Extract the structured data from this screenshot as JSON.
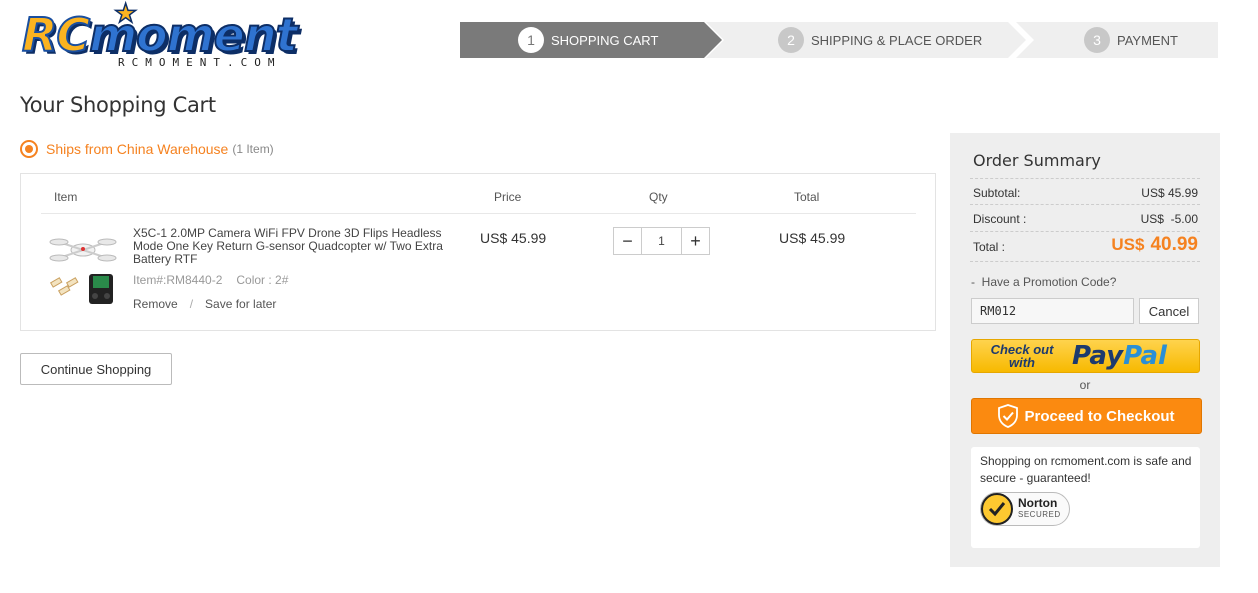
{
  "logo": {
    "rc": "RC",
    "moment": "moment",
    "domain": "RCMOMENT.COM"
  },
  "steps": [
    {
      "num": "1",
      "label": "SHOPPING CART"
    },
    {
      "num": "2",
      "label": "SHIPPING & PLACE ORDER"
    },
    {
      "num": "3",
      "label": "PAYMENT"
    }
  ],
  "page_title": "Your Shopping Cart",
  "warehouse": {
    "name": "Ships from China Warehouse",
    "count": "(1 Item)"
  },
  "cart": {
    "headers": {
      "item": "Item",
      "price": "Price",
      "qty": "Qty",
      "total": "Total"
    },
    "items": [
      {
        "title": "X5C-1 2.0MP Camera WiFi FPV Drone 3D Flips Headless Mode One Key Return G-sensor Quadcopter w/ Two Extra Battery RTF",
        "item_no": "Item#:RM8440-2",
        "color": "Color : 2#",
        "remove": "Remove",
        "sep": "/",
        "save": "Save for later",
        "price": "US$ 45.99",
        "qty": "1",
        "total": "US$ 45.99"
      }
    ]
  },
  "continue_label": "Continue Shopping",
  "summary": {
    "title": "Order Summary",
    "subtotal_label": "Subtotal:",
    "subtotal": "US$ 45.99",
    "discount_label": "Discount :",
    "discount": "US$  -5.00",
    "total_label": "Total :",
    "total_currency": "US$",
    "total_value": "40.99",
    "promo_label": "-  Have a Promotion Code?",
    "promo_code": "RM012",
    "cancel_label": "Cancel",
    "paypal_check": "Check out",
    "paypal_with": "with",
    "paypal_pay": "Pay",
    "paypal_pal": "Pal",
    "or": "or",
    "checkout_label": "Proceed to Checkout",
    "secure_text": "Shopping on rcmoment.com is safe and secure - guaranteed!",
    "norton_name": "Norton",
    "norton_secured": "SECURED"
  },
  "colors": {
    "accent": "#f58220",
    "step_active": "#7a7a7a",
    "paypal": "#f7b900",
    "checkout": "#fb8a10"
  }
}
